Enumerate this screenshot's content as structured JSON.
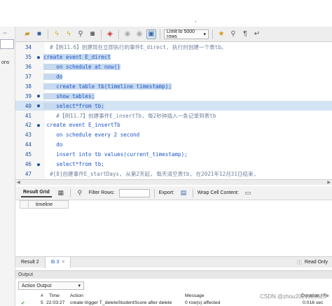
{
  "toolbar": {
    "limit_label": "Limit to 5000 rows"
  },
  "editor": {
    "lines": [
      {
        "num": "34",
        "dot": "",
        "code": "  #【例11.6】创建现在立即执行的事件E_direct, 执行时创建一个表tb。",
        "cls": "cm",
        "sel": false
      },
      {
        "num": "35",
        "dot": "●",
        "code": "create event E_direct",
        "cls": "kw",
        "sel": true
      },
      {
        "num": "36",
        "dot": "",
        "code": "    on schedule at now()",
        "cls": "kw",
        "sel": true
      },
      {
        "num": "37",
        "dot": "",
        "code": "    do",
        "cls": "kw",
        "sel": true
      },
      {
        "num": "38",
        "dot": "",
        "code": "    create table tb(timeline timestamp);",
        "cls": "kw",
        "sel": true
      },
      {
        "num": "39",
        "dot": "●",
        "code": "    show tables;",
        "cls": "kw",
        "sel": true
      },
      {
        "num": "40",
        "dot": "●",
        "code": "    select*from tb;",
        "cls": "kw",
        "sel": "cursor"
      },
      {
        "num": "41",
        "dot": "",
        "code": "    #【例11.7】创建事件E_insertTb, 每2秒钟插入一条记录到表tb",
        "cls": "cm",
        "sel": false
      },
      {
        "num": "42",
        "dot": "●",
        "code": " create event E_insertTb",
        "cls": "kw",
        "sel": false
      },
      {
        "num": "43",
        "dot": "",
        "code": "    on schedule every 2 second",
        "cls": "kw",
        "sel": false
      },
      {
        "num": "44",
        "dot": "",
        "code": "    do",
        "cls": "kw",
        "sel": false
      },
      {
        "num": "45",
        "dot": "",
        "code": "    insert into tb values(current_timestamp);",
        "cls": "kw",
        "sel": false
      },
      {
        "num": "46",
        "dot": "●",
        "code": "    select*from tb;",
        "cls": "kw",
        "sel": false
      },
      {
        "num": "47",
        "dot": "",
        "code": "  #[8]创建事件E_startDays, 从第2天起, 每天清空表tb, 在2021年12月31日结束,",
        "cls": "cm",
        "sel": false
      }
    ]
  },
  "result_bar": {
    "result_grid": "Result Grid",
    "filter_rows": "Filter Rows:",
    "export": "Export:",
    "wrap": "Wrap Cell Content:"
  },
  "grid": {
    "column": "timeline"
  },
  "tabs": {
    "result2": "Result 2",
    "tb3": "tb 3",
    "read_only": "Read Only"
  },
  "output": {
    "title": "Output",
    "selector": "Action Output",
    "headers": {
      "num": "#",
      "time": "Time",
      "action": "Action",
      "message": "Message",
      "duration": "Duration / Fe"
    },
    "row": {
      "num": "5",
      "time": "22:03:27",
      "action": "create trigger T_deleteStudentScore after delete",
      "message": "0 row(s) affected",
      "duration": "0.016 sec"
    }
  },
  "top_text": ",",
  "left_label": "ons",
  "watermark": "CSDN @zhou2021026625"
}
